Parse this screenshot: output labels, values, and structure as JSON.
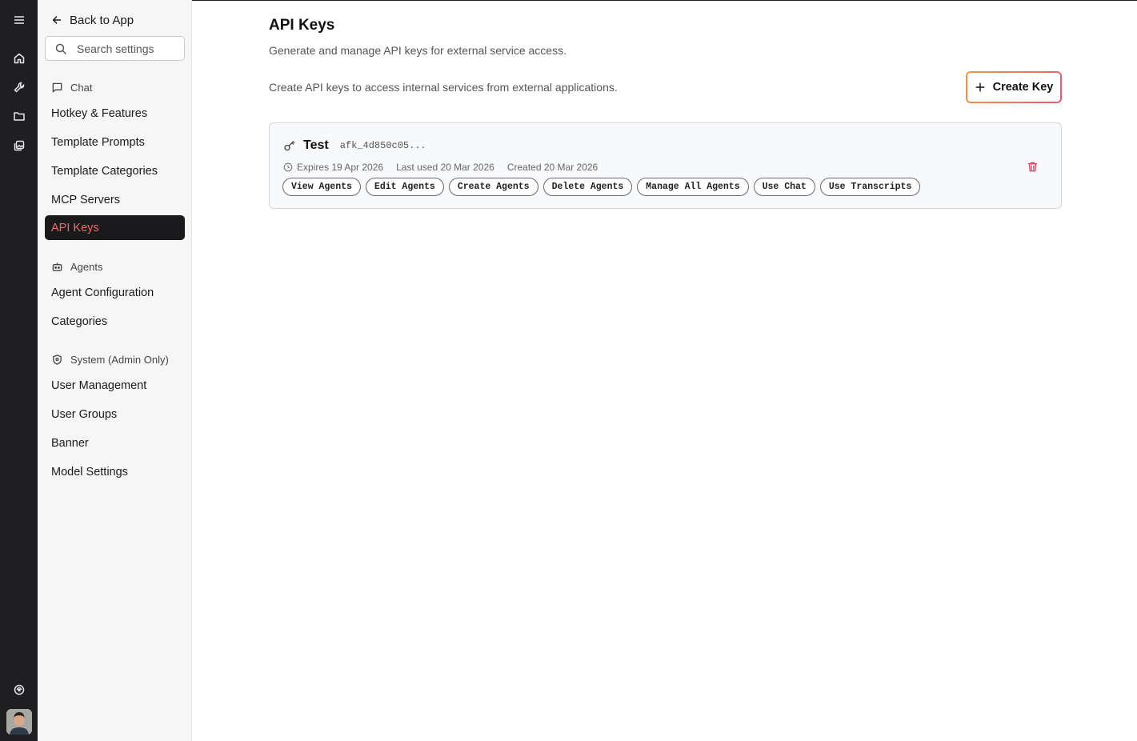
{
  "sidebar": {
    "back_label": "Back to App",
    "search_placeholder": "Search settings",
    "sections": {
      "chat": {
        "title": "Chat",
        "items": [
          "Hotkey & Features",
          "Template Prompts",
          "Template Categories",
          "MCP Servers",
          "API Keys"
        ]
      },
      "agents": {
        "title": "Agents",
        "items": [
          "Agent Configuration",
          "Categories"
        ]
      },
      "system": {
        "title": "System (Admin Only)",
        "items": [
          "User Management",
          "User Groups",
          "Banner",
          "Model Settings"
        ]
      }
    },
    "active_item": "API Keys"
  },
  "main": {
    "title": "API Keys",
    "subtitle": "Generate and manage API keys for external service access.",
    "description": "Create API keys to access internal services from external applications.",
    "create_button_label": "Create Key",
    "keys": [
      {
        "name": "Test",
        "prefix": "afk_4d850c05...",
        "expires": "Expires 19 Apr 2026",
        "last_used": "Last used 20 Mar 2026",
        "created": "Created 20 Mar 2026",
        "permissions": [
          "View Agents",
          "Edit Agents",
          "Create Agents",
          "Delete Agents",
          "Manage All Agents",
          "Use Chat",
          "Use Transcripts"
        ]
      }
    ]
  },
  "colors": {
    "rail_bg": "#1f1f22",
    "active_nav_bg": "#1a1a1d",
    "active_nav_text": "#f06a62",
    "accent_gradient_start": "#f29a3c",
    "accent_gradient_end": "#e85a78",
    "delete_icon": "#d93a5c"
  },
  "icons": {
    "rail": [
      "menu-icon",
      "home-icon",
      "wrench-icon",
      "folder-icon",
      "gallery-icon",
      "chat-support-icon"
    ],
    "back": "arrow-left-icon",
    "search": "search-icon",
    "chat_section": "message-square-icon",
    "agents_section": "bot-icon",
    "system_section": "shield-icon",
    "create": "plus-icon",
    "key": "key-icon",
    "expires": "clock-icon",
    "delete": "trash-icon"
  }
}
